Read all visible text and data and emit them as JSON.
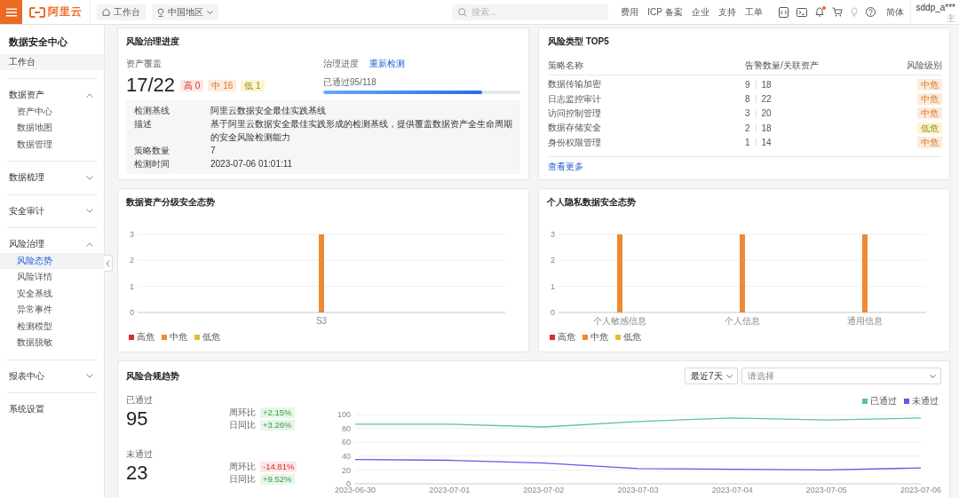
{
  "topbar": {
    "logo": "阿里云",
    "nav_buttons": [
      {
        "label": "工作台",
        "kind": "home"
      },
      {
        "label": "中国地区",
        "kind": "region"
      }
    ],
    "search": {
      "placeholder": "搜索..."
    },
    "links": [
      "费用",
      "ICP 备案",
      "企业",
      "支持",
      "工单"
    ],
    "notification_dot": true,
    "language": "简体",
    "user": {
      "name": "sddp_a***",
      "role": "主"
    }
  },
  "sidebar": {
    "title": "数据安全中心",
    "items": [
      {
        "label": "工作台",
        "kind": "home",
        "selected": false
      },
      {
        "label": "数据资产",
        "kind": "group",
        "expanded": true,
        "children": [
          {
            "label": "资产中心",
            "selected": false
          },
          {
            "label": "数据地图",
            "selected": false
          },
          {
            "label": "数据管理",
            "selected": false
          }
        ]
      },
      {
        "label": "数据梳理",
        "kind": "group",
        "expanded": false
      },
      {
        "label": "安全审计",
        "kind": "group",
        "expanded": false
      },
      {
        "label": "风险治理",
        "kind": "group",
        "expanded": true,
        "children": [
          {
            "label": "风险态势",
            "selected": true
          },
          {
            "label": "风险详情",
            "selected": false
          },
          {
            "label": "安全基线",
            "selected": false
          },
          {
            "label": "异常事件",
            "selected": false
          },
          {
            "label": "检测模型",
            "selected": false
          },
          {
            "label": "数据脱敏",
            "selected": false
          }
        ]
      },
      {
        "label": "报表中心",
        "kind": "group",
        "expanded": false
      },
      {
        "label": "系统设置",
        "kind": "link",
        "selected": false
      }
    ]
  },
  "governance": {
    "title": "风险治理进度",
    "coverage": {
      "label": "资产覆盖",
      "value": "17/22",
      "badges": [
        {
          "text": "高 0",
          "kind": "high"
        },
        {
          "text": "中 16",
          "kind": "medium"
        },
        {
          "text": "低 1",
          "kind": "low"
        }
      ]
    },
    "progress": {
      "label": "治理进度",
      "action": "重新检测",
      "caption": "已通过95/118",
      "level": 0.805
    },
    "details": [
      {
        "label": "检测基线",
        "value": "阿里云数据安全最佳实践基线"
      },
      {
        "label": "描述",
        "value": "基于阿里云数据安全最佳实践形成的检测基线，提供覆盖数据资产全生命周期的安全风险检测能力"
      },
      {
        "label": "策略数量",
        "value": "7"
      },
      {
        "label": "检测时间",
        "value": "2023-07-06 01:01:11"
      }
    ]
  },
  "top_risks": {
    "title": "风险类型 TOP5",
    "columns": [
      "策略名称",
      "告警数量/关联资产",
      "风险级别"
    ],
    "rows": [
      {
        "name": "数据传输加密",
        "alerts": "9",
        "assets": "18",
        "risk": "中危",
        "kind": "medium"
      },
      {
        "name": "日志监控审计",
        "alerts": "8",
        "assets": "22",
        "risk": "中危",
        "kind": "medium"
      },
      {
        "name": "访问控制管理",
        "alerts": "3",
        "assets": "20",
        "risk": "中危",
        "kind": "medium"
      },
      {
        "name": "数据存储安全",
        "alerts": "2",
        "assets": "18",
        "risk": "低危",
        "kind": "low"
      },
      {
        "name": "身份权限管理",
        "alerts": "1",
        "assets": "14",
        "risk": "中危",
        "kind": "medium"
      }
    ],
    "more": "查看更多"
  },
  "asset_chart": {
    "title": "数据资产分级安全态势",
    "chart_data": {
      "type": "bar",
      "categories": [
        "S3"
      ],
      "series": [
        {
          "name": "高危",
          "color": "#d8312a",
          "values": [
            0
          ]
        },
        {
          "name": "中危",
          "color": "#ed8a33",
          "values": [
            3
          ]
        },
        {
          "name": "低危",
          "color": "#e6bb34",
          "values": [
            0
          ]
        }
      ],
      "ylim": [
        0,
        3
      ],
      "yticks": [
        0,
        1,
        2,
        3
      ],
      "grid": true,
      "legend": "bottom-left"
    }
  },
  "privacy_chart": {
    "title": "个人隐私数据安全态势",
    "chart_data": {
      "type": "bar",
      "categories": [
        "个人敏感信息",
        "个人信息",
        "通用信息"
      ],
      "series": [
        {
          "name": "高危",
          "color": "#d8312a",
          "values": [
            0,
            0,
            0
          ]
        },
        {
          "name": "中危",
          "color": "#ed8a33",
          "values": [
            3,
            3,
            3
          ]
        },
        {
          "name": "低危",
          "color": "#e6bb34",
          "values": [
            0,
            0,
            0
          ]
        }
      ],
      "ylim": [
        0,
        3
      ],
      "yticks": [
        0,
        1,
        2,
        3
      ],
      "grid": true,
      "legend": "bottom-left"
    }
  },
  "compliance_trend": {
    "title": "风险合规趋势",
    "period": {
      "value": "最近7天"
    },
    "filter": {
      "placeholder": "请选择"
    },
    "stats": [
      {
        "label": "已通过",
        "value": "95",
        "changes": [
          {
            "label": "周环比",
            "value": "+2.15%",
            "kind": "good"
          },
          {
            "label": "日同比",
            "value": "+3.26%",
            "kind": "good"
          }
        ]
      },
      {
        "label": "未通过",
        "value": "23",
        "changes": [
          {
            "label": "周环比",
            "value": "-14.81%",
            "kind": "bad"
          },
          {
            "label": "日同比",
            "value": "+9.52%",
            "kind": "good"
          }
        ]
      }
    ],
    "chart_data": {
      "type": "line",
      "x": [
        "2023-06-30",
        "2023-07-01",
        "2023-07-02",
        "2023-07-03",
        "2023-07-04",
        "2023-07-05",
        "2023-07-06"
      ],
      "series": [
        {
          "name": "已通过",
          "color": "#5cc3a0",
          "values": [
            86,
            86,
            82,
            90,
            95,
            92,
            95
          ]
        },
        {
          "name": "未通过",
          "color": "#5b5bea",
          "values": [
            35,
            34,
            30,
            22,
            21,
            20,
            23
          ]
        }
      ],
      "ylim": [
        0,
        100
      ],
      "yticks": [
        0,
        20,
        40,
        60,
        80,
        100
      ],
      "grid": true,
      "legend": "top-right"
    }
  }
}
